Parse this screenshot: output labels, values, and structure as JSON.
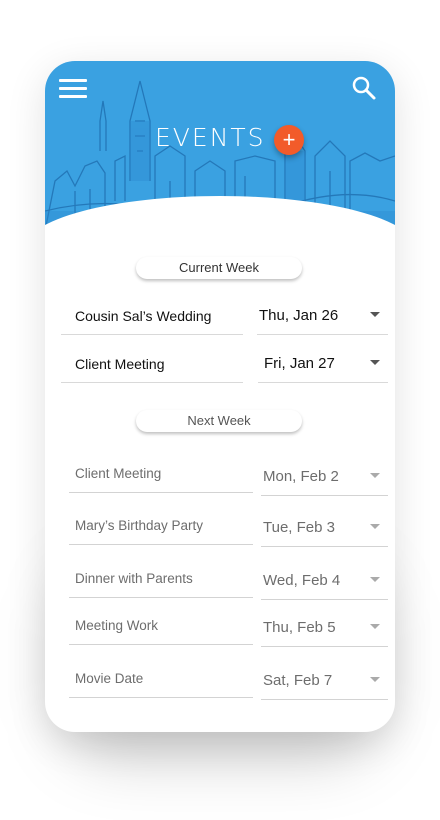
{
  "header": {
    "title": "EVENTS",
    "add_label": "+",
    "icons": {
      "menu": "hamburger-menu-icon",
      "search": "search-icon",
      "add": "plus-icon"
    },
    "colors": {
      "header_bg": "#3aa1e1",
      "accent": "#f25b2a"
    }
  },
  "sections": {
    "current_week": {
      "label": "Current Week",
      "events": [
        {
          "name": "Cousin Sal’s Wedding",
          "date": "Thu, Jan 26"
        },
        {
          "name": "Client Meeting",
          "date": "Fri, Jan 27"
        }
      ]
    },
    "next_week": {
      "label": "Next Week",
      "events": [
        {
          "name": "Client Meeting",
          "date": "Mon, Feb 2"
        },
        {
          "name": "Mary’s Birthday Party",
          "date": "Tue,  Feb 3"
        },
        {
          "name": "Dinner with Parents",
          "date": "Wed,  Feb 4"
        },
        {
          "name": "Meeting Work",
          "date": "Thu,  Feb 5"
        },
        {
          "name": "Movie Date",
          "date": "Sat,  Feb 7"
        }
      ]
    }
  }
}
